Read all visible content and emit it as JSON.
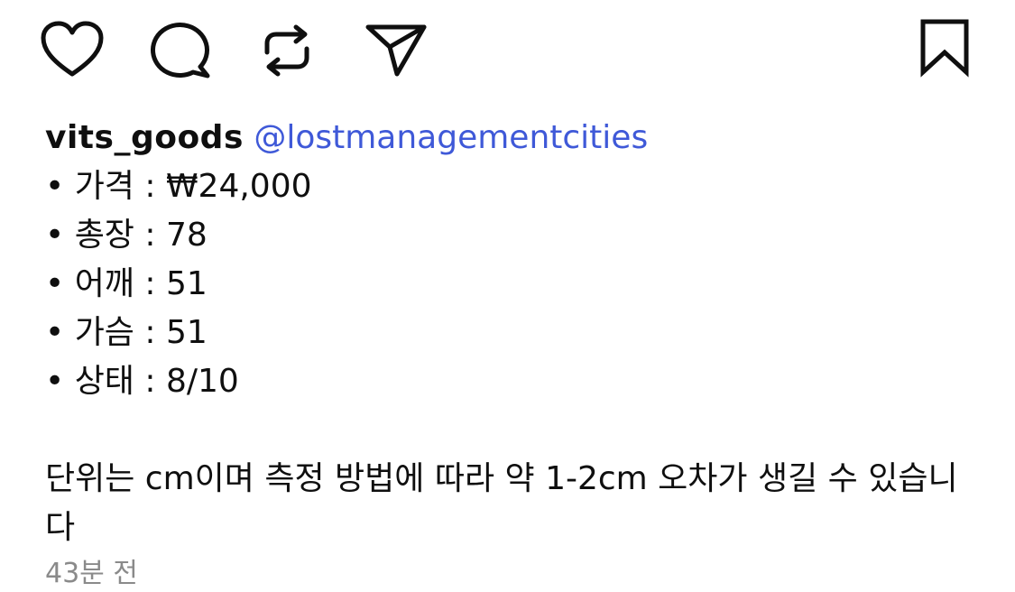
{
  "actions": {
    "like_icon": "heart-icon",
    "comment_icon": "speech-bubble-icon",
    "repost_icon": "repost-icon",
    "share_icon": "paper-plane-icon",
    "save_icon": "bookmark-icon"
  },
  "post": {
    "username": "vits_goods",
    "mention": "@lostmanagementcities",
    "bullet": "•",
    "specs": [
      "가격 : ₩24,000",
      "총장 : 78",
      "어깨 : 51",
      "가슴 : 51",
      "상태 : 8/10"
    ],
    "note": "단위는 cm이며 측정 방법에 따라 약 1-2cm 오차가 생길 수 있습니다",
    "timestamp": "43분 전"
  },
  "colors": {
    "text": "#0f0f0f",
    "mention": "#3f59d8",
    "timestamp": "#8a8a8a",
    "background": "#ffffff"
  }
}
